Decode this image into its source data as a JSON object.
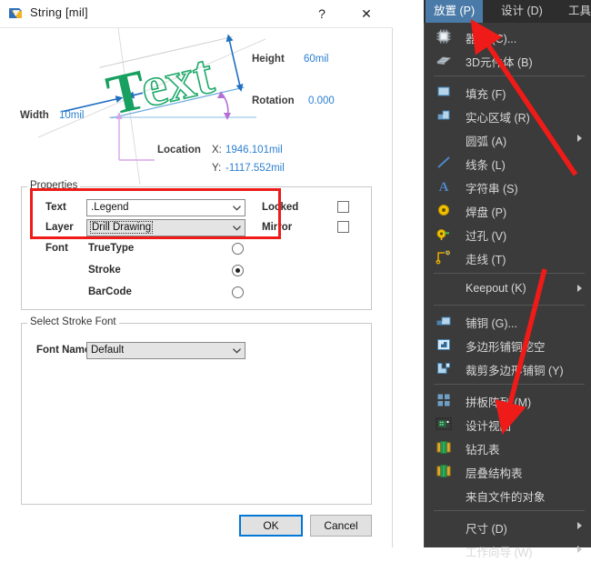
{
  "dialog": {
    "title": "String  [mil]",
    "help_label": "?",
    "close_label": "✕",
    "preview": {
      "sample_text": "Text",
      "height_label": "Height",
      "height_value": "60mil",
      "rotation_label": "Rotation",
      "rotation_value": "0.000",
      "width_label": "Width",
      "width_value": "10mil",
      "location_label": "Location",
      "x_label": "X:",
      "x_value": "1946.101mil",
      "y_label": "Y:",
      "y_value": "-1117.552mil"
    },
    "properties": {
      "group_title": "Properties",
      "text_label": "Text",
      "text_value": ".Legend",
      "layer_label": "Layer",
      "layer_value": "Drill Drawing",
      "font_label": "Font",
      "font_options": [
        "TrueType",
        "Stroke",
        "BarCode"
      ],
      "font_selected": "Stroke",
      "locked_label": "Locked",
      "locked_checked": false,
      "mirror_label": "Mirror",
      "mirror_checked": false
    },
    "stroke_font": {
      "group_title": "Select Stroke Font",
      "font_name_label": "Font Name",
      "font_name_value": "Default"
    },
    "buttons": {
      "ok": "OK",
      "cancel": "Cancel"
    }
  },
  "menu": {
    "menubar": [
      {
        "label": "放置 (P)",
        "active": true
      },
      {
        "label": "设计 (D)",
        "active": false
      },
      {
        "label": "工具 (T)",
        "active": false
      }
    ],
    "items": [
      {
        "label": "器件 (C)...",
        "icon": "chip-icon",
        "arrow": false,
        "sep_after": false
      },
      {
        "label": "3D元件体 (B)",
        "icon": "3d-body-icon",
        "arrow": false,
        "sep_after": true
      },
      {
        "label": "填充 (F)",
        "icon": "fill-icon",
        "arrow": false,
        "sep_after": false
      },
      {
        "label": "实心区域 (R)",
        "icon": "solid-region-icon",
        "arrow": false,
        "sep_after": false
      },
      {
        "label": "圆弧 (A)",
        "icon": "none",
        "arrow": true,
        "sep_after": false
      },
      {
        "label": "线条 (L)",
        "icon": "line-icon",
        "arrow": false,
        "sep_after": false
      },
      {
        "label": "字符串 (S)",
        "icon": "string-icon",
        "arrow": false,
        "sep_after": false
      },
      {
        "label": "焊盘 (P)",
        "icon": "pad-icon",
        "arrow": false,
        "sep_after": false
      },
      {
        "label": "过孔 (V)",
        "icon": "via-icon",
        "arrow": false,
        "sep_after": false
      },
      {
        "label": "走线 (T)",
        "icon": "track-icon",
        "arrow": false,
        "sep_after": true
      },
      {
        "label": "Keepout (K)",
        "icon": "none",
        "arrow": true,
        "sep_after": true
      },
      {
        "label": "铺铜 (G)...",
        "icon": "polygon-pour-icon",
        "arrow": false,
        "sep_after": false
      },
      {
        "label": "多边形铺铜挖空",
        "icon": "polygon-cutout-icon",
        "arrow": false,
        "sep_after": false
      },
      {
        "label": "裁剪多边形铺铜 (Y)",
        "icon": "polygon-trim-icon",
        "arrow": false,
        "sep_after": true
      },
      {
        "label": "拼板阵列 (M)",
        "icon": "panel-array-icon",
        "arrow": false,
        "sep_after": false
      },
      {
        "label": "设计视图",
        "icon": "design-view-icon",
        "arrow": false,
        "sep_after": false
      },
      {
        "label": "钻孔表",
        "icon": "drill-table-icon",
        "arrow": false,
        "sep_after": false
      },
      {
        "label": "层叠结构表",
        "icon": "layer-stack-icon",
        "arrow": false,
        "sep_after": false
      },
      {
        "label": "来自文件的对象",
        "icon": "none",
        "arrow": false,
        "sep_after": true
      },
      {
        "label": "尺寸 (D)",
        "icon": "none",
        "arrow": true,
        "sep_after": false
      },
      {
        "label": "工作向导 (W)",
        "icon": "none",
        "arrow": true,
        "sep_after": false
      }
    ]
  },
  "annotations": {
    "arrow_color": "#ee1b18",
    "highlight_color": "#ee1b18",
    "arrow_1_target": "放置 (P)",
    "arrow_2_target": "钻孔表"
  }
}
